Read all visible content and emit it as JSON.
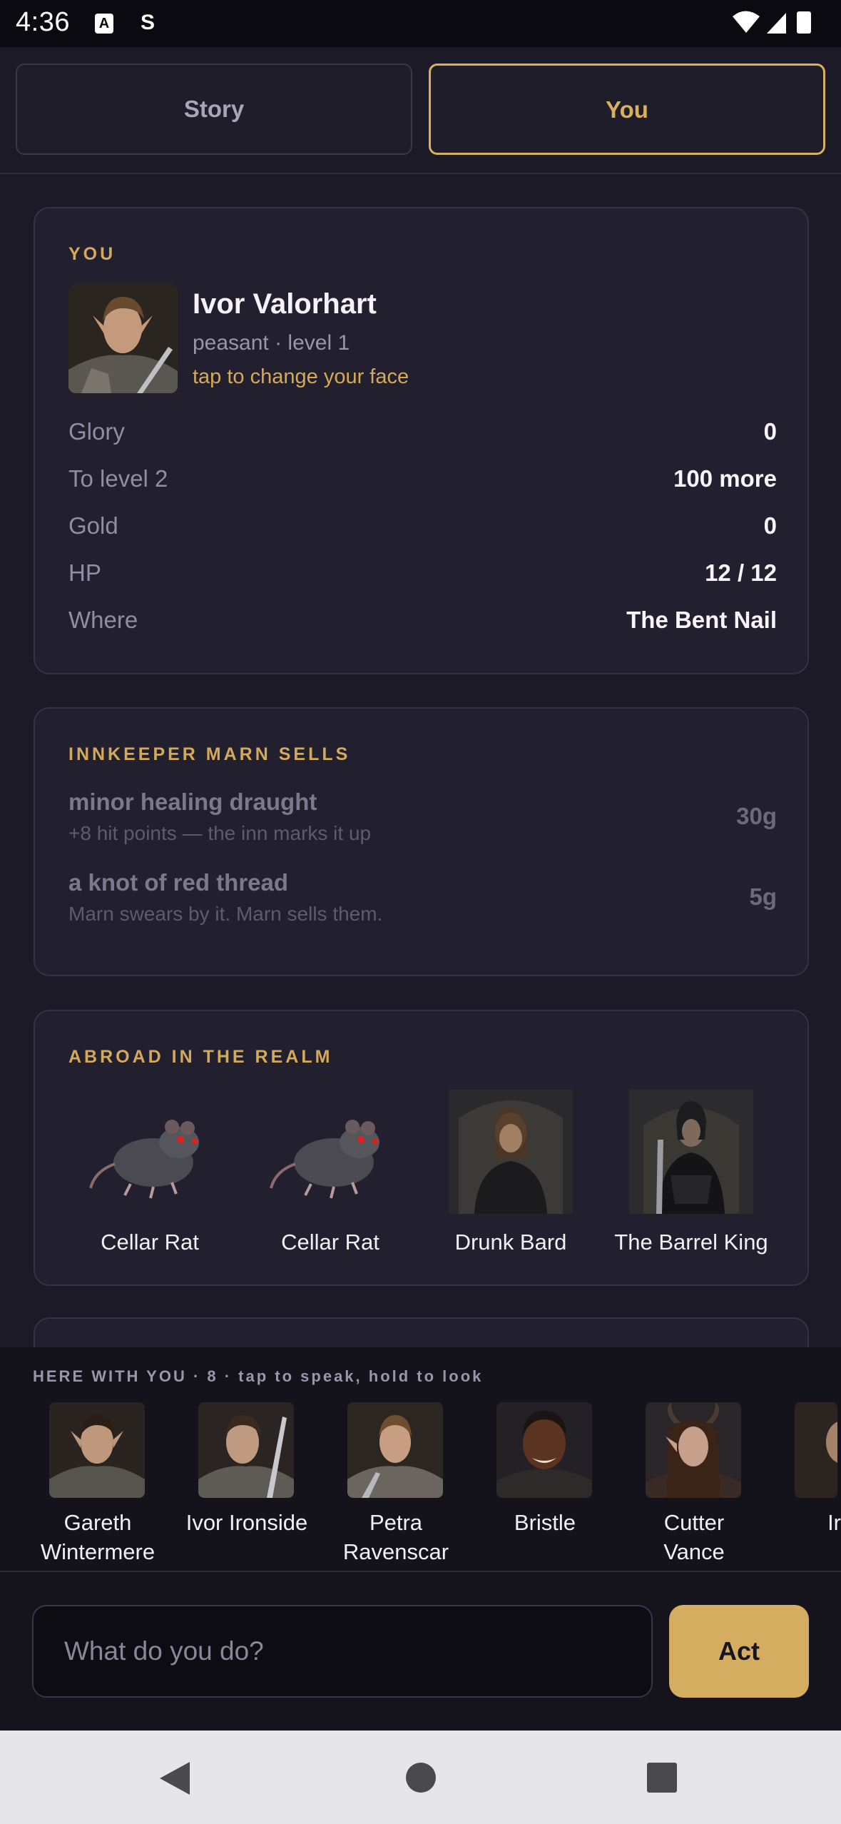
{
  "status_bar": {
    "time": "4:36",
    "icon_a_letter": "A",
    "icon_s_letter": "S"
  },
  "tabs": [
    {
      "label": "Story",
      "active": false
    },
    {
      "label": "You",
      "active": true
    }
  ],
  "you_card": {
    "section_title": "YOU",
    "name": "Ivor Valorhart",
    "subline": "peasant · level 1",
    "face_link": "tap to change your face",
    "stats": [
      {
        "label": "Glory",
        "value": "0"
      },
      {
        "label": "To level 2",
        "value": "100 more"
      },
      {
        "label": "Gold",
        "value": "0"
      },
      {
        "label": "HP",
        "value": "12 / 12"
      },
      {
        "label": "Where",
        "value": "The Bent Nail"
      }
    ]
  },
  "shop_card": {
    "section_title": "INNKEEPER MARN SELLS",
    "items": [
      {
        "name": "minor healing draught",
        "description": "+8 hit points — the inn marks it up",
        "price": "30g"
      },
      {
        "name": "a knot of red thread",
        "description": "Marn swears by it. Marn sells them.",
        "price": "5g"
      }
    ]
  },
  "realm_card": {
    "section_title": "ABROAD IN THE REALM",
    "creatures": [
      {
        "label": "Cellar Rat",
        "icon": "rat-portrait"
      },
      {
        "label": "Cellar Rat",
        "icon": "rat-portrait"
      },
      {
        "label": "Drunk Bard",
        "icon": "bard-portrait"
      },
      {
        "label": "The Barrel King",
        "icon": "armored-king-portrait"
      }
    ]
  },
  "here_panel": {
    "title": "HERE WITH YOU · 8 · tap to speak, hold to look",
    "people": [
      {
        "name": "Gareth\nWintermere"
      },
      {
        "name": "Ivor Ironside"
      },
      {
        "name": "Petra\nRavenscar"
      },
      {
        "name": "Bristle"
      },
      {
        "name": "Cutter\nVance"
      },
      {
        "name": "Ir"
      }
    ]
  },
  "action_bar": {
    "placeholder": "What do you do?",
    "button_label": "Act"
  },
  "colors": {
    "accent": "#d4ad61",
    "background": "#1c1a26",
    "card": "#221f2e"
  }
}
